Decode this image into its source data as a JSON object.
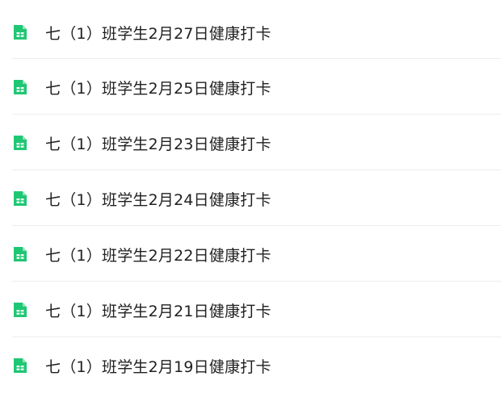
{
  "files": [
    {
      "title": "七（1）班学生2月27日健康打卡",
      "icon": "spreadsheet-icon"
    },
    {
      "title": "七（1）班学生2月25日健康打卡",
      "icon": "spreadsheet-icon"
    },
    {
      "title": "七（1）班学生2月23日健康打卡",
      "icon": "spreadsheet-icon"
    },
    {
      "title": "七（1）班学生2月24日健康打卡",
      "icon": "spreadsheet-icon"
    },
    {
      "title": "七（1）班学生2月22日健康打卡",
      "icon": "spreadsheet-icon"
    },
    {
      "title": "七（1）班学生2月21日健康打卡",
      "icon": "spreadsheet-icon"
    },
    {
      "title": "七（1）班学生2月19日健康打卡",
      "icon": "spreadsheet-icon"
    }
  ],
  "colors": {
    "icon_green": "#1fc774",
    "text": "#1f1f1f",
    "divider": "#ececec"
  }
}
